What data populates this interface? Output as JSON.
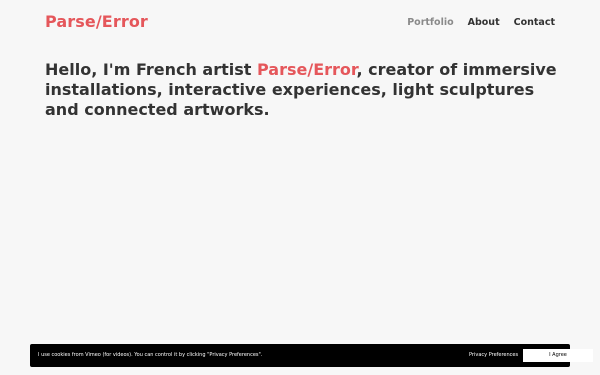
{
  "header": {
    "logo_text": "Parse/Error",
    "nav": [
      {
        "label": "Portfolio"
      },
      {
        "label": "About"
      },
      {
        "label": "Contact"
      }
    ]
  },
  "intro": {
    "prefix": "Hello, I'm French artist ",
    "name": "Parse/Error",
    "suffix": ", creator of immersive installations, interactive experiences, light sculptures and connected artworks."
  },
  "cookie_banner": {
    "message": "I use cookies from Vimeo (for videos). You can control it by clicking \"Privacy Preferences\".",
    "preferences_label": "Privacy Preferences",
    "agree_label": "I Agree"
  },
  "colors": {
    "accent": "#e5575b",
    "background": "#f7f7f7",
    "text": "#333333",
    "banner": "#000000"
  }
}
